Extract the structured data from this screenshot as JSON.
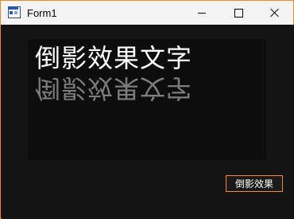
{
  "window": {
    "title": "Form1",
    "accent_color": "#f08a28",
    "controls": {
      "minimize_icon": "minimize-icon",
      "maximize_icon": "maximize-icon",
      "close_icon": "close-icon"
    }
  },
  "panel": {
    "text": "倒影效果文字",
    "reflection_text": "倒影效果文字"
  },
  "button": {
    "label": "倒影效果"
  }
}
